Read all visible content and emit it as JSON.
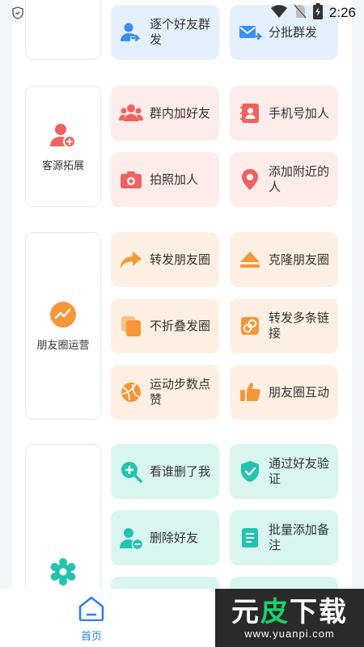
{
  "status_bar": {
    "time": "2:26",
    "icons": [
      "shield-icon",
      "wifi-icon",
      "no-sim-icon",
      "battery-charging-icon"
    ]
  },
  "sections": [
    {
      "category": "",
      "tiles": [
        {
          "label": "逐个好友群发",
          "icon": "user-send-icon"
        },
        {
          "label": "分批群发",
          "icon": "mail-forward-icon"
        }
      ]
    },
    {
      "category": "客源拓展",
      "tiles": [
        {
          "label": "群内加好友",
          "icon": "group-users-icon"
        },
        {
          "label": "手机号加人",
          "icon": "contact-book-icon"
        },
        {
          "label": "拍照加人",
          "icon": "camera-icon"
        },
        {
          "label": "添加附近的人",
          "icon": "location-pin-icon"
        }
      ]
    },
    {
      "category": "朋友圈运营",
      "tiles": [
        {
          "label": "转发朋友圈",
          "icon": "forward-arrow-icon"
        },
        {
          "label": "克隆朋友圈",
          "icon": "eject-icon"
        },
        {
          "label": "不折叠发圈",
          "icon": "copy-icon"
        },
        {
          "label": "转发多条链接",
          "icon": "link-icon"
        },
        {
          "label": "运动步数点赞",
          "icon": "ball-icon"
        },
        {
          "label": "朋友圈互动",
          "icon": "thumbs-up-icon"
        }
      ]
    },
    {
      "category": "",
      "tiles": [
        {
          "label": "看谁删了我",
          "icon": "search-plus-icon"
        },
        {
          "label": "通过好友验证",
          "icon": "shield-check-icon"
        },
        {
          "label": "删除好友",
          "icon": "user-minus-icon"
        },
        {
          "label": "批量添加备注",
          "icon": "note-icon"
        }
      ]
    }
  ],
  "bottom_nav": {
    "home_label": "首页"
  },
  "watermark": {
    "brand_a": "元",
    "brand_b": "皮",
    "brand_c": "下载",
    "url": "www.yuanpi.com"
  },
  "colors": {
    "accent": "#2f7df6",
    "blue": "#3a8ef6",
    "pink": "#f0625f",
    "orange": "#f5973a",
    "teal": "#23c4ae"
  }
}
